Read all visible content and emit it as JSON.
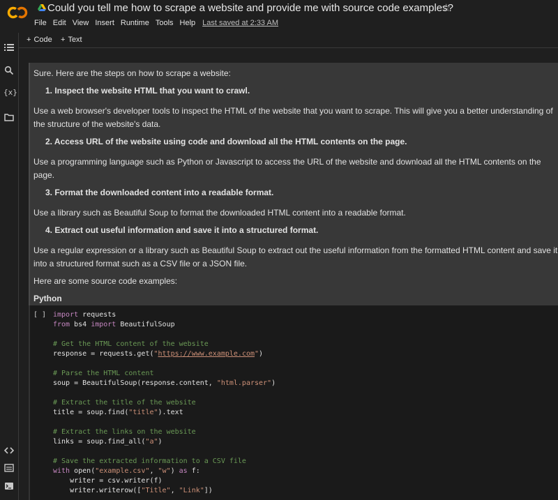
{
  "header": {
    "title": "Could you tell me how to scrape a website and provide me with source code examples?",
    "star_icon": "star-outline-icon",
    "menu": [
      "File",
      "Edit",
      "View",
      "Insert",
      "Runtime",
      "Tools",
      "Help"
    ],
    "last_saved": "Last saved at 2:33 AM"
  },
  "toolbar": {
    "code_label": "Code",
    "text_label": "Text"
  },
  "rail_icons": [
    "toc-icon",
    "search-icon",
    "variables-icon",
    "folder-icon",
    "code-snippets-icon",
    "command-palette-icon",
    "terminal-icon"
  ],
  "text_cell": {
    "intro": "Sure. Here are the steps on how to scrape a website:",
    "steps": [
      {
        "heading": "1. Inspect the website HTML that you want to crawl.",
        "body": "Use a web browser's developer tools to inspect the HTML of the website that you want to scrape. This will give you a better understanding of the structure of the website's data."
      },
      {
        "heading": "2. Access URL of the website using code and download all the HTML contents on the page.",
        "body": "Use a programming language such as Python or Javascript to access the URL of the website and download all the HTML contents on the page."
      },
      {
        "heading": "3. Format the downloaded content into a readable format.",
        "body": "Use a library such as Beautiful Soup to format the downloaded HTML content into a readable format."
      },
      {
        "heading": "4. Extract out useful information and save it into a structured format.",
        "body": "Use a regular expression or a library such as Beautiful Soup to extract out the useful information from the formatted HTML content and save it into a structured format such as a CSV file or a JSON file."
      }
    ],
    "examples_intro": "Here are some source code examples:",
    "language": "Python"
  },
  "code_cell": {
    "run_indicator": "[ ]",
    "lines": [
      "import requests",
      "from bs4 import BeautifulSoup",
      "",
      "# Get the HTML content of the website",
      "response = requests.get(\"https://www.example.com\")",
      "",
      "# Parse the HTML content",
      "soup = BeautifulSoup(response.content, \"html.parser\")",
      "",
      "# Extract the title of the website",
      "title = soup.find(\"title\").text",
      "",
      "# Extract the links on the website",
      "links = soup.find_all(\"a\")",
      "",
      "# Save the extracted information to a CSV file",
      "with open(\"example.csv\", \"w\") as f:",
      "    writer = csv.writer(f)",
      "    writer.writerow([\"Title\", \"Link\"])"
    ]
  },
  "colors": {
    "background": "#1f1f1f",
    "text_cell_bg": "#383838",
    "code_cell_bg": "#1a1a1a",
    "keyword": "#c586c0",
    "comment": "#6a9955",
    "string": "#ce9178",
    "logo_orange": "#f9ab00",
    "logo_dark": "#e37400"
  }
}
